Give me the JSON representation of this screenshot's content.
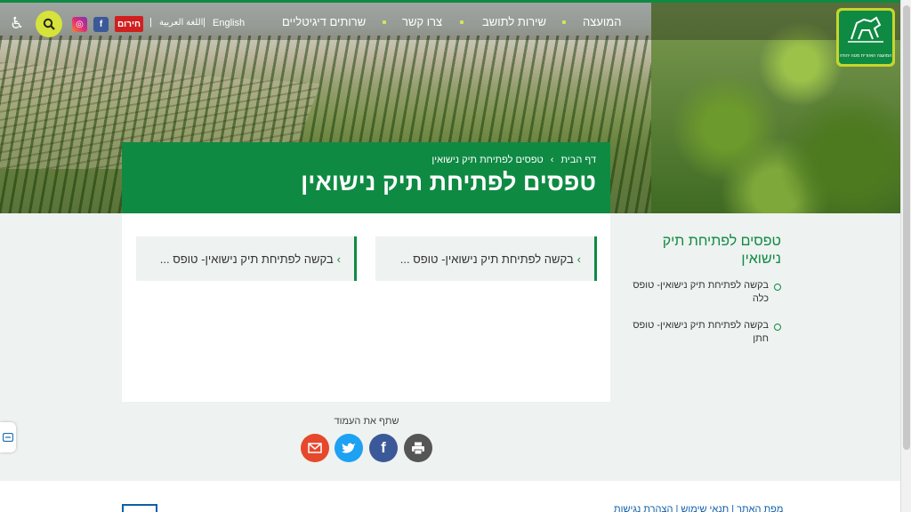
{
  "nav": {
    "items": [
      "המועצה",
      "שירות לתושב",
      "צרו קשר",
      "שרותים דיגיטליים"
    ],
    "lang_en": "English",
    "lang_ar": "اللغة العربية",
    "separator": "|",
    "emergency": "חירום",
    "facebook_glyph": "f",
    "instagram_glyph": "◎",
    "accessibility_glyph": "♿"
  },
  "logo": {
    "text": "המועצה האזורית מטה יהודה"
  },
  "breadcrumb": {
    "home": "דף הבית",
    "separator": "›",
    "current": "טפסים לפתיחת תיק נישואין"
  },
  "page": {
    "title": "טפסים לפתיחת תיק נישואין"
  },
  "tiles": [
    {
      "label": "בקשה לפתיחת תיק נישואין- טופס ...",
      "arrow": "›"
    },
    {
      "label": "בקשה לפתיחת תיק נישואין- טופס ...",
      "arrow": "›"
    }
  ],
  "sidebar": {
    "title": "טפסים לפתיחת תיק נישואין",
    "items": [
      {
        "label": "בקשה לפתיחת תיק נישואין- טופס כלה"
      },
      {
        "label": "בקשה לפתיחת תיק נישואין- טופס חתן"
      }
    ]
  },
  "share": {
    "label": "שתף את העמוד"
  },
  "footer": {
    "links": "מפת האתר | תנאי שימוש | הצהרת נגישות"
  },
  "colors": {
    "brand_green": "#0f8a43",
    "accent_lime": "#d6e33a",
    "emergency_red": "#d11f1f",
    "facebook": "#3b5998",
    "twitter": "#1da1f2",
    "mail": "#e5482b",
    "print": "#555555"
  }
}
